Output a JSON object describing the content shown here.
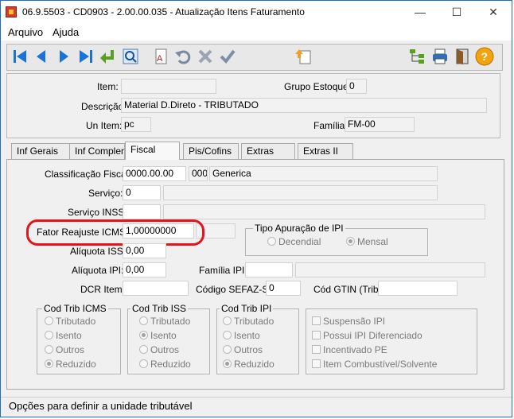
{
  "window": {
    "title": "06.9.5503 - CD0903 - 2.00.00.035 - Atualização Itens Faturamento",
    "minimize": "—",
    "maximize": "☐",
    "close": "✕"
  },
  "menu": {
    "arquivo": "Arquivo",
    "ajuda": "Ajuda"
  },
  "toolbar": {
    "icons": [
      "first-icon",
      "prev-icon",
      "next-icon",
      "last-icon",
      "goto-icon",
      "search-zoom-icon",
      "report-icon",
      "undo-icon",
      "delete-icon",
      "confirm-icon",
      "upload-icon",
      "tree-icon",
      "print-icon",
      "exit-icon",
      "help-icon"
    ]
  },
  "header": {
    "item_label": "Item:",
    "item_value": "",
    "grupo_estoque_label": "Grupo Estoque:",
    "grupo_estoque_value": "0",
    "descricao_label": "Descrição:",
    "descricao_value": "Material D.Direto - TRIBUTADO",
    "un_item_label": "Un Item:",
    "un_item_value": "pc",
    "familia_label": "Família:",
    "familia_value": "FM-00"
  },
  "tabs": [
    {
      "label": "Inf Gerais"
    },
    {
      "label": "Inf Complem"
    },
    {
      "label": "Fiscal"
    },
    {
      "label": "Pis/Cofins"
    },
    {
      "label": "Extras"
    },
    {
      "label": "Extras II"
    }
  ],
  "fiscal": {
    "classificacao_label": "Classificação Fiscal:",
    "classificacao_value": "0000.00.00",
    "classificacao_code": "000",
    "classificacao_desc": "Generica",
    "servico_label": "Serviço:",
    "servico_value": "0",
    "servico_inss_label": "Serviço INSS:",
    "fator_label": "Fator Reajuste ICMS:",
    "fator_value": "1,00000000",
    "tipo_apuracao_title": "Tipo Apuração de IPI",
    "decendial": "Decendial",
    "mensal": "Mensal",
    "aliquota_iss_label": "Alíquota ISS:",
    "aliquota_iss_value": "0,00",
    "aliquota_ipi_label": "Alíquota IPI:",
    "aliquota_ipi_value": "0,00",
    "familia_ipi_label": "Família IPI:",
    "dcr_label": "DCR Item:",
    "sefaz_label": "Código SEFAZ-SP:",
    "sefaz_value": "0",
    "gtin_label": "Cód GTIN (Trib):"
  },
  "groups": {
    "icms": {
      "title": "Cod Trib ICMS",
      "options": [
        "Tributado",
        "Isento",
        "Outros",
        "Reduzido"
      ],
      "selected": "Reduzido"
    },
    "iss": {
      "title": "Cod Trib ISS",
      "options": [
        "Tributado",
        "Isento",
        "Outros",
        "Reduzido"
      ],
      "selected": "Isento"
    },
    "ipi": {
      "title": "Cod Trib IPI",
      "options": [
        "Tributado",
        "Isento",
        "Outros",
        "Reduzido"
      ],
      "selected": "Reduzido"
    },
    "checks": [
      "Suspensão IPI",
      "Possui IPI Diferenciado",
      "Incentivado PE",
      "Item Combustível/Solvente"
    ]
  },
  "status": {
    "text": "Opções para definir a unidade tributável"
  },
  "colors": {
    "highlight": "#e3141c",
    "toolbar_blue": "#1a73d9"
  }
}
